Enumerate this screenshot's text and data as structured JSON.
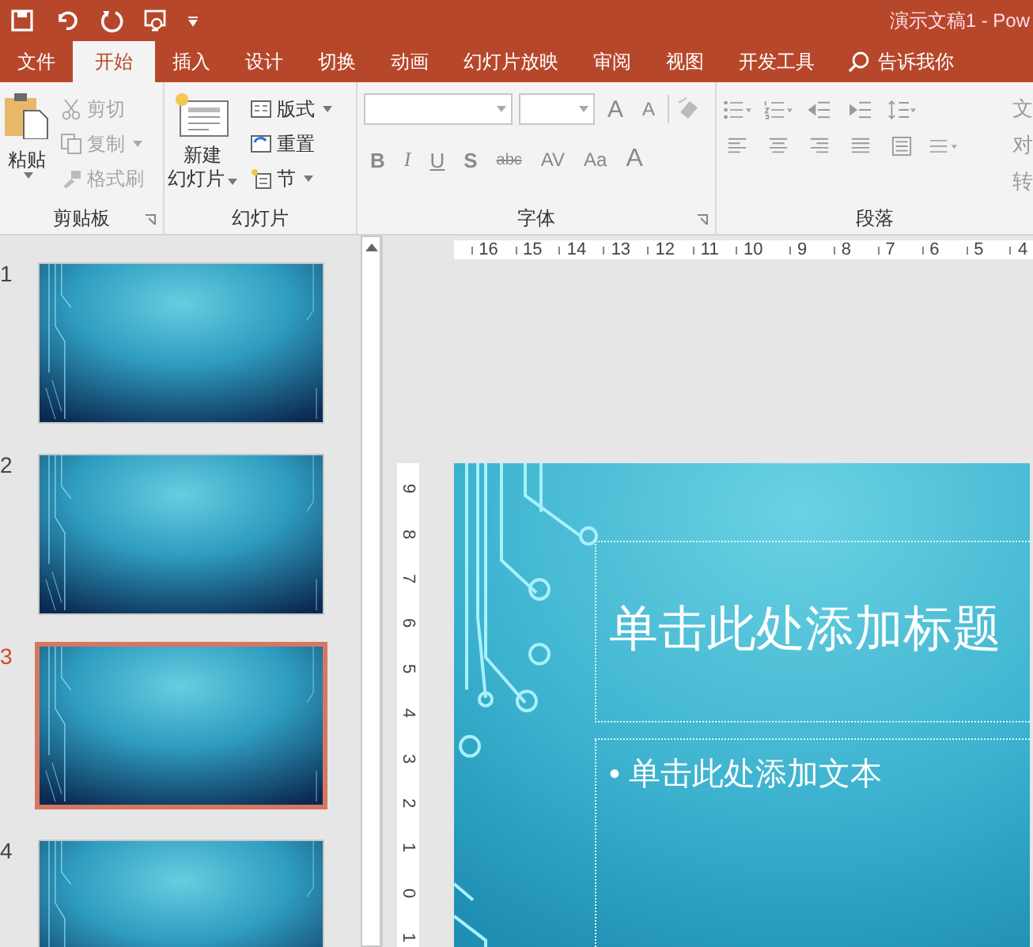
{
  "window": {
    "title": "演示文稿1 - Pow"
  },
  "tabs": [
    {
      "label": "文件",
      "selected": false
    },
    {
      "label": "开始",
      "selected": true
    },
    {
      "label": "插入",
      "selected": false
    },
    {
      "label": "设计",
      "selected": false
    },
    {
      "label": "切换",
      "selected": false
    },
    {
      "label": "动画",
      "selected": false
    },
    {
      "label": "幻灯片放映",
      "selected": false
    },
    {
      "label": "审阅",
      "selected": false
    },
    {
      "label": "视图",
      "selected": false
    },
    {
      "label": "开发工具",
      "selected": false
    }
  ],
  "tell_me": {
    "label": "告诉我你"
  },
  "clipboard": {
    "label": "剪贴板",
    "paste": {
      "label": "粘贴",
      "disabled": false
    },
    "cut": {
      "label": "剪切",
      "disabled": true
    },
    "copy": {
      "label": "复制",
      "disabled": true
    },
    "format_painter": {
      "label": "格式刷",
      "disabled": true
    }
  },
  "slides_group": {
    "label": "幻灯片",
    "new_slide": {
      "lines": [
        "新建",
        "幻灯片"
      ],
      "disabled": false
    },
    "layout": {
      "label": "版式",
      "disabled": false
    },
    "reset": {
      "label": "重置",
      "disabled": false
    },
    "section": {
      "label": "节",
      "disabled": false
    }
  },
  "font": {
    "label": "字体",
    "grow_shrink": [
      "A",
      "A"
    ],
    "format_buttons": [
      "B",
      "I",
      "U",
      "S",
      "abc",
      "AV",
      "Aa",
      "A"
    ]
  },
  "paragraph": {
    "label": "段落",
    "cut_labels": [
      "文",
      "对",
      "转"
    ]
  },
  "slides": [
    {
      "number": "1",
      "selected": false
    },
    {
      "number": "2",
      "selected": false
    },
    {
      "number": "3",
      "selected": true
    },
    {
      "number": "4",
      "selected": false
    }
  ],
  "horizontal_ruler": [
    "16",
    "15",
    "14",
    "13",
    "12",
    "11",
    "10",
    "9",
    "8",
    "7",
    "6",
    "5",
    "4"
  ],
  "vertical_ruler": [
    "9",
    "8",
    "7",
    "6",
    "5",
    "4",
    "3",
    "2",
    "1",
    "0",
    "1"
  ],
  "slide": {
    "title": "单击此处添加标题",
    "bullet": "•",
    "body": "单击此处添加文本"
  }
}
